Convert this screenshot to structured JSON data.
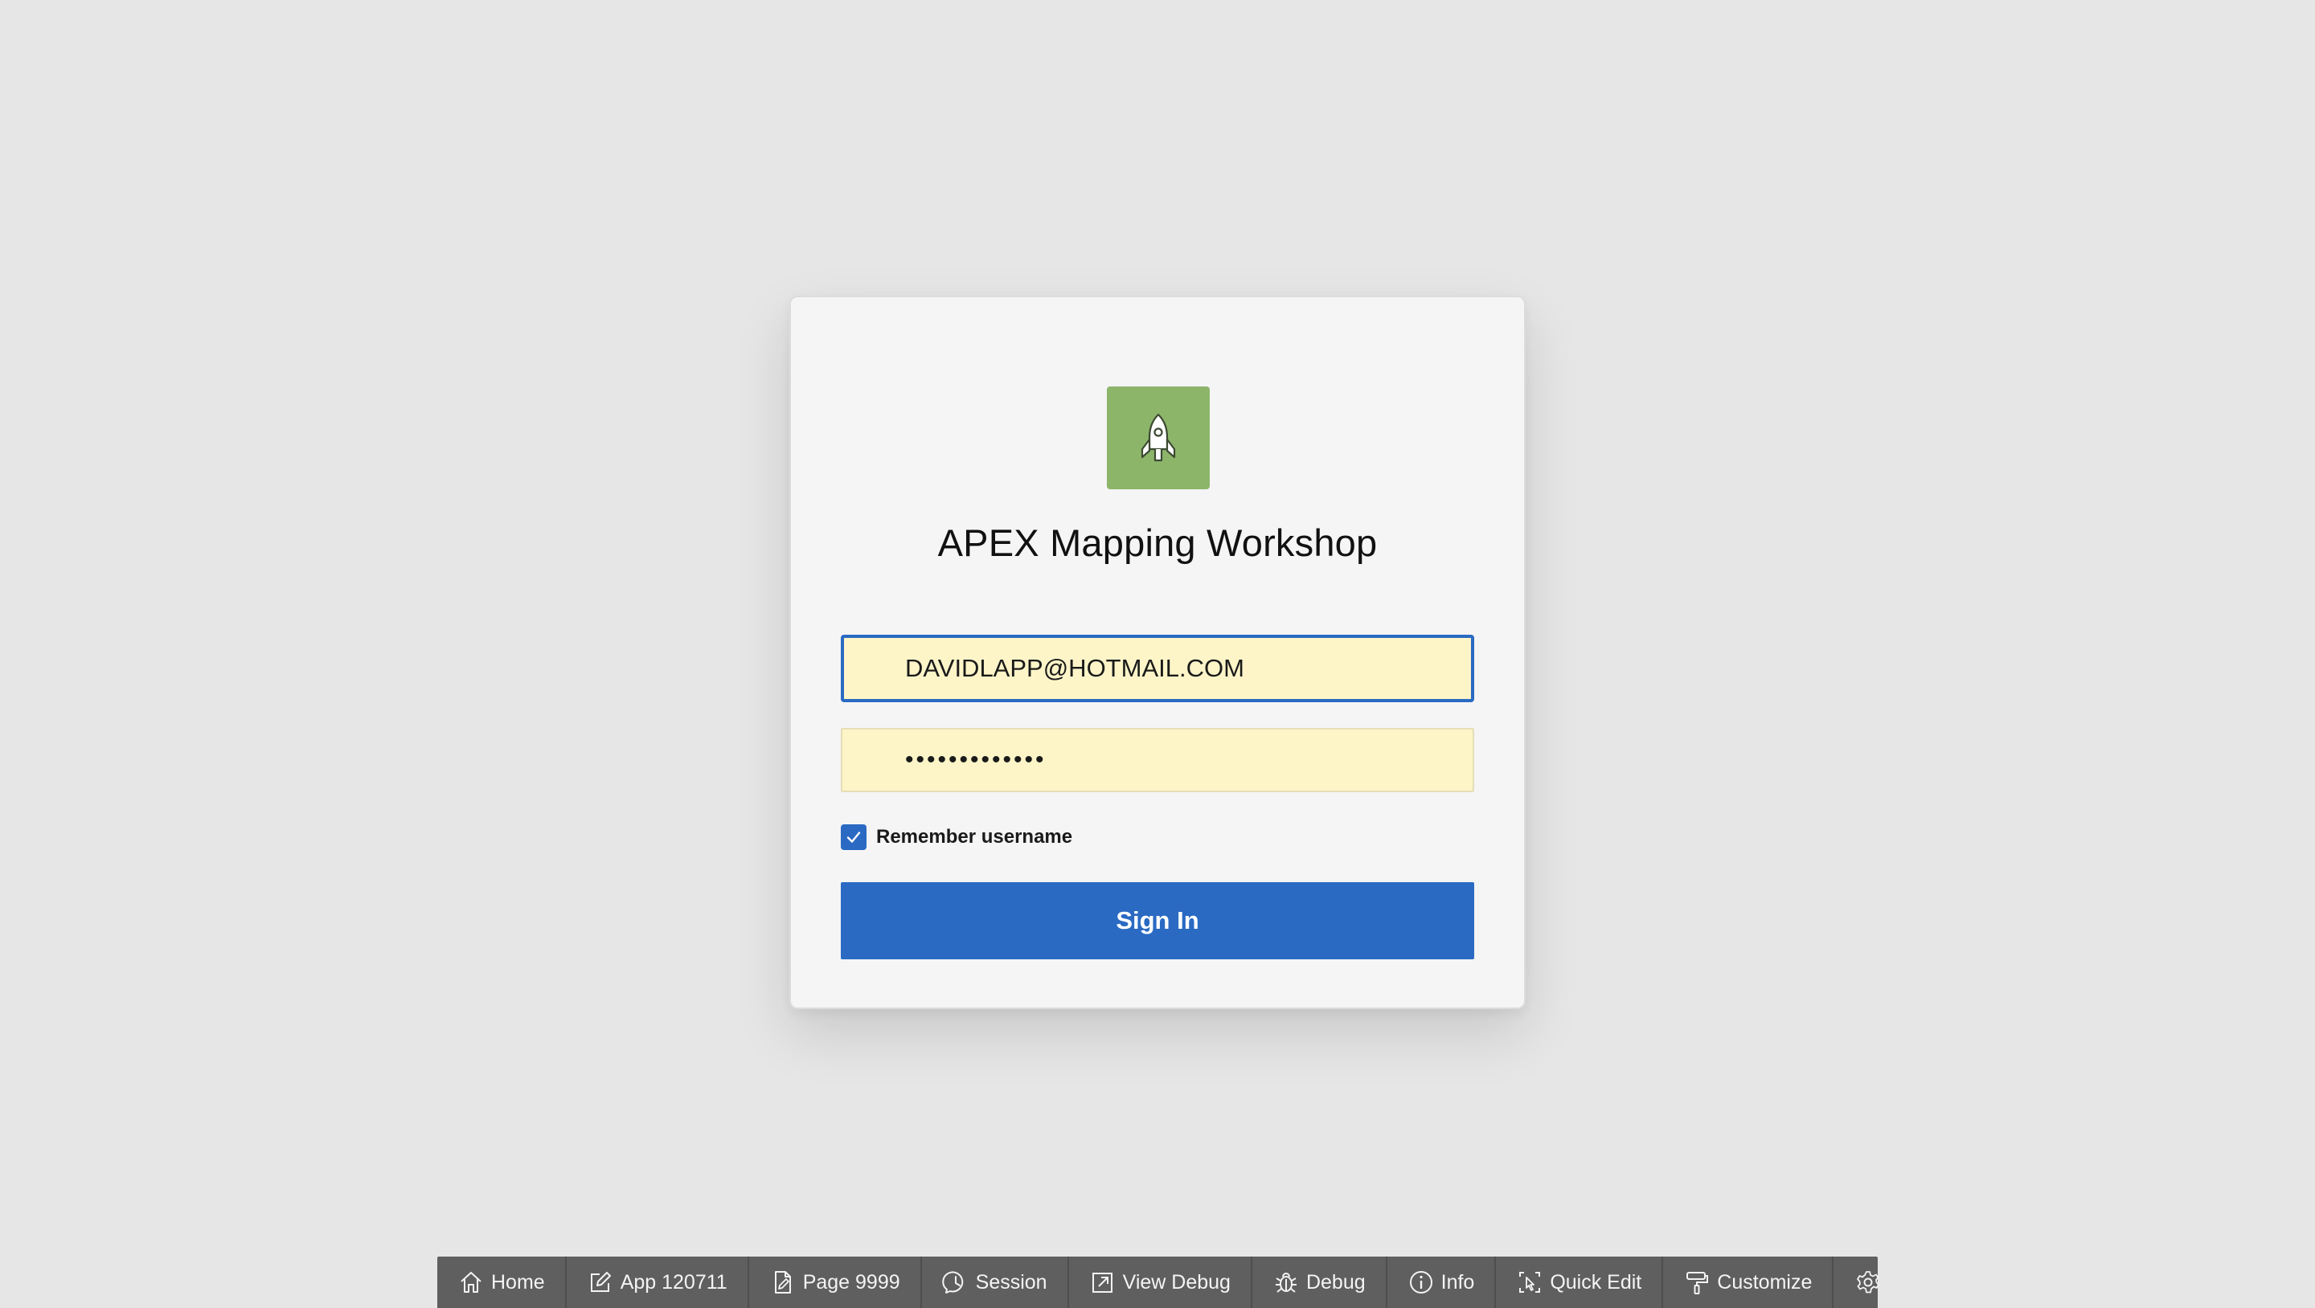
{
  "app": {
    "title": "APEX Mapping Workshop",
    "logo_icon": "rocket-icon",
    "logo_color": "#8cb56a"
  },
  "login": {
    "username_value": "DAVIDLAPP@HOTMAIL.COM",
    "password_display": "•••••••••••••",
    "remember_label": "Remember username",
    "remember_checked": true,
    "sign_in_label": "Sign In"
  },
  "colors": {
    "primary": "#2a6ac3",
    "field_autofill": "#fdf5c8",
    "toolbar_bg": "#5f5f5f",
    "page_bg": "#e6e6e6"
  },
  "toolbar": {
    "items": [
      {
        "label": "Home",
        "icon": "home-icon"
      },
      {
        "label": "App 120711",
        "icon": "edit-icon"
      },
      {
        "label": "Page 9999",
        "icon": "page-edit-icon"
      },
      {
        "label": "Session",
        "icon": "session-icon"
      },
      {
        "label": "View Debug",
        "icon": "external-link-icon"
      },
      {
        "label": "Debug",
        "icon": "bug-icon"
      },
      {
        "label": "Info",
        "icon": "info-icon"
      },
      {
        "label": "Quick Edit",
        "icon": "quick-edit-icon"
      },
      {
        "label": "Customize",
        "icon": "paint-roller-icon"
      },
      {
        "label": "",
        "icon": "gear-icon"
      }
    ]
  }
}
